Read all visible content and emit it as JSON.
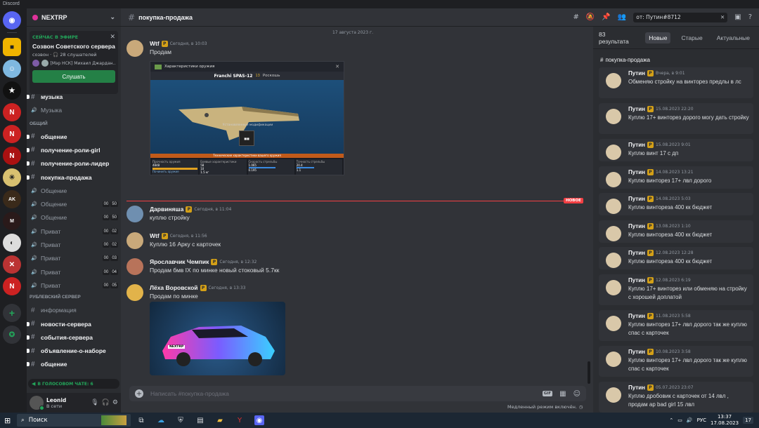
{
  "window_title": "Discord",
  "server": {
    "name": "NEXTRP",
    "live": {
      "label": "СЕЙЧАС В ЭФИРЕ",
      "title": "Созвон Советского сервера",
      "sub": "созвон · 🎧 28 слушателей",
      "speakers": "[Мэр НСК] Михаил Джардан...",
      "button": "Слушать"
    }
  },
  "channels": {
    "top": [
      {
        "name": "музыка",
        "type": "text",
        "unread": true
      },
      {
        "name": "Музыка",
        "type": "voice",
        "unread": false
      }
    ],
    "cat1": "ОБЩИЙ",
    "list1": [
      {
        "name": "общение",
        "type": "text",
        "unread": true,
        "counts": []
      },
      {
        "name": "получение-роли-girl",
        "type": "text",
        "unread": true,
        "counts": []
      },
      {
        "name": "получение-роли-лидер",
        "type": "text",
        "unread": true,
        "counts": []
      },
      {
        "name": "покупка-продажа",
        "type": "text",
        "unread": true,
        "counts": []
      },
      {
        "name": "Общение",
        "type": "voice",
        "unread": false,
        "counts": []
      },
      {
        "name": "Общение",
        "type": "voice",
        "unread": false,
        "counts": [
          "00",
          "50"
        ]
      },
      {
        "name": "Общение",
        "type": "voice",
        "unread": false,
        "counts": [
          "00",
          "50"
        ]
      },
      {
        "name": "Приват",
        "type": "voice",
        "unread": false,
        "counts": [
          "00",
          "02"
        ]
      },
      {
        "name": "Приват",
        "type": "voice",
        "unread": false,
        "counts": [
          "00",
          "02"
        ]
      },
      {
        "name": "Приват",
        "type": "voice",
        "unread": false,
        "counts": [
          "00",
          "03"
        ]
      },
      {
        "name": "Приват",
        "type": "voice",
        "unread": false,
        "counts": [
          "00",
          "04"
        ]
      },
      {
        "name": "Приват",
        "type": "voice",
        "unread": false,
        "counts": [
          "00",
          "05"
        ]
      }
    ],
    "cat2": "РУБЛЕВСКИЙ СЕРВЕР",
    "list2": [
      {
        "name": "информация",
        "type": "text",
        "unread": false
      },
      {
        "name": "новости-сервера",
        "type": "text",
        "unread": true
      },
      {
        "name": "события-сервера",
        "type": "text",
        "unread": true
      },
      {
        "name": "объявление-о-наборе",
        "type": "text",
        "unread": true
      },
      {
        "name": "общение",
        "type": "text",
        "unread": true
      }
    ],
    "voice_chat": "В ГОЛОСОВОМ ЧАТЕ: 6"
  },
  "user": {
    "name": "Leonid",
    "status": "В сети"
  },
  "channel": {
    "name": "покупка-продажа",
    "search": "от: Путин#8712",
    "date_divider": "17 августа 2023 г.",
    "new_label": "НОВОЕ"
  },
  "messages": [
    {
      "author": "Wtf",
      "time": "Сегодня, в 10:03",
      "text": "Продам",
      "avatar": "#c9a97a"
    },
    {
      "author": "Дарвиняша",
      "time": "Сегодня, в 11:04",
      "text": "куплю стройку",
      "avatar": "#6f8fb0"
    },
    {
      "author": "Wtf",
      "time": "Сегодня, в 11:56",
      "text": "Куплю 16 Арку с карточек",
      "avatar": "#c9a97a"
    },
    {
      "author": "Ярославчик Чемпик",
      "time": "Сегодня, в 12:32",
      "text": "Продам бмв IX по минке новый стоковый 5.7кк",
      "avatar": "#b8735a"
    },
    {
      "author": "Лёха Воровской",
      "time": "Сегодня, в 13:33",
      "text": "Продам по минке",
      "avatar": "#e2b34a"
    }
  ],
  "weapon_card": {
    "header": "Характеристики оружия",
    "name": "Franchi SPAS-12",
    "level": "13",
    "rarity": "Роскошь",
    "mods_label": "Установленные модификации",
    "stats_label": "Технические характеристики вашего оружия",
    "col1": "Прочность оружия",
    "col2": "Боевые характеристики",
    "col3": "Скорость стрельбы",
    "col4": "Точность стрельбы",
    "durability": "4848",
    "repair": "Починить оружие",
    "damage": "58",
    "hits": "10",
    "mass": "1.5 кг",
    "v1": "1.065",
    "v2": "0.195",
    "v3": "20.4",
    "v4": "1.1"
  },
  "car_plate": "NEXTRP",
  "composer": {
    "placeholder": "Написать #покупка-продажа",
    "gif": "GIF",
    "slowmode": "Медленный режим включён."
  },
  "search_panel": {
    "count": "83 результата",
    "tabs": [
      "Новые",
      "Старые",
      "Актуальные"
    ],
    "channel": "покупка-продажа",
    "results": [
      {
        "author": "Путин",
        "time": "Вчера, в 9:01",
        "text": "Обменяю стройку на винторез предлы в лс"
      },
      {
        "author": "Путин",
        "time": "15.08.2023 22:20",
        "text": "Куплю 17+ винторез дорого могу дать стройку"
      },
      {
        "author": "Путин",
        "time": "15.08.2023 9:01",
        "text": "Куплю винт 17 с дп"
      },
      {
        "author": "Путин",
        "time": "14.08.2023 13:21",
        "text": "Куплю винторез 17+ лвл дорого"
      },
      {
        "author": "Путин",
        "time": "14.08.2023 5:03",
        "text": "Куплю винтореза 400 кк бюджет"
      },
      {
        "author": "Путин",
        "time": "13.08.2023 1:10",
        "text": "Куплю винтореза 400 кк бюджет"
      },
      {
        "author": "Путин",
        "time": "12.08.2023 12:28",
        "text": "Куплю винтореза 400 кк бюджет"
      },
      {
        "author": "Путин",
        "time": "12.08.2023 6:19",
        "text": "Куплю 17+ винторез или обменяю на стройку с хорошей доплатой"
      },
      {
        "author": "Путин",
        "time": "11.08.2023 5:58",
        "text": "Куплю винторез 17+ лвл дорого так же куплю спас с карточек"
      },
      {
        "author": "Путин",
        "time": "10.08.2023 3:58",
        "text": "Куплю винторез 17+ лвл дорого так же куплю спас с карточек"
      },
      {
        "author": "Путин",
        "time": "05.07.2023 23:07",
        "text": "Куплю дробовик с карточек от 14 лвл , продам ар bad girl 15 лвл"
      }
    ]
  },
  "taskbar": {
    "search": "Поиск",
    "lang": "РУС",
    "time": "13:37",
    "date": "17.08.2023",
    "notif": "17"
  }
}
